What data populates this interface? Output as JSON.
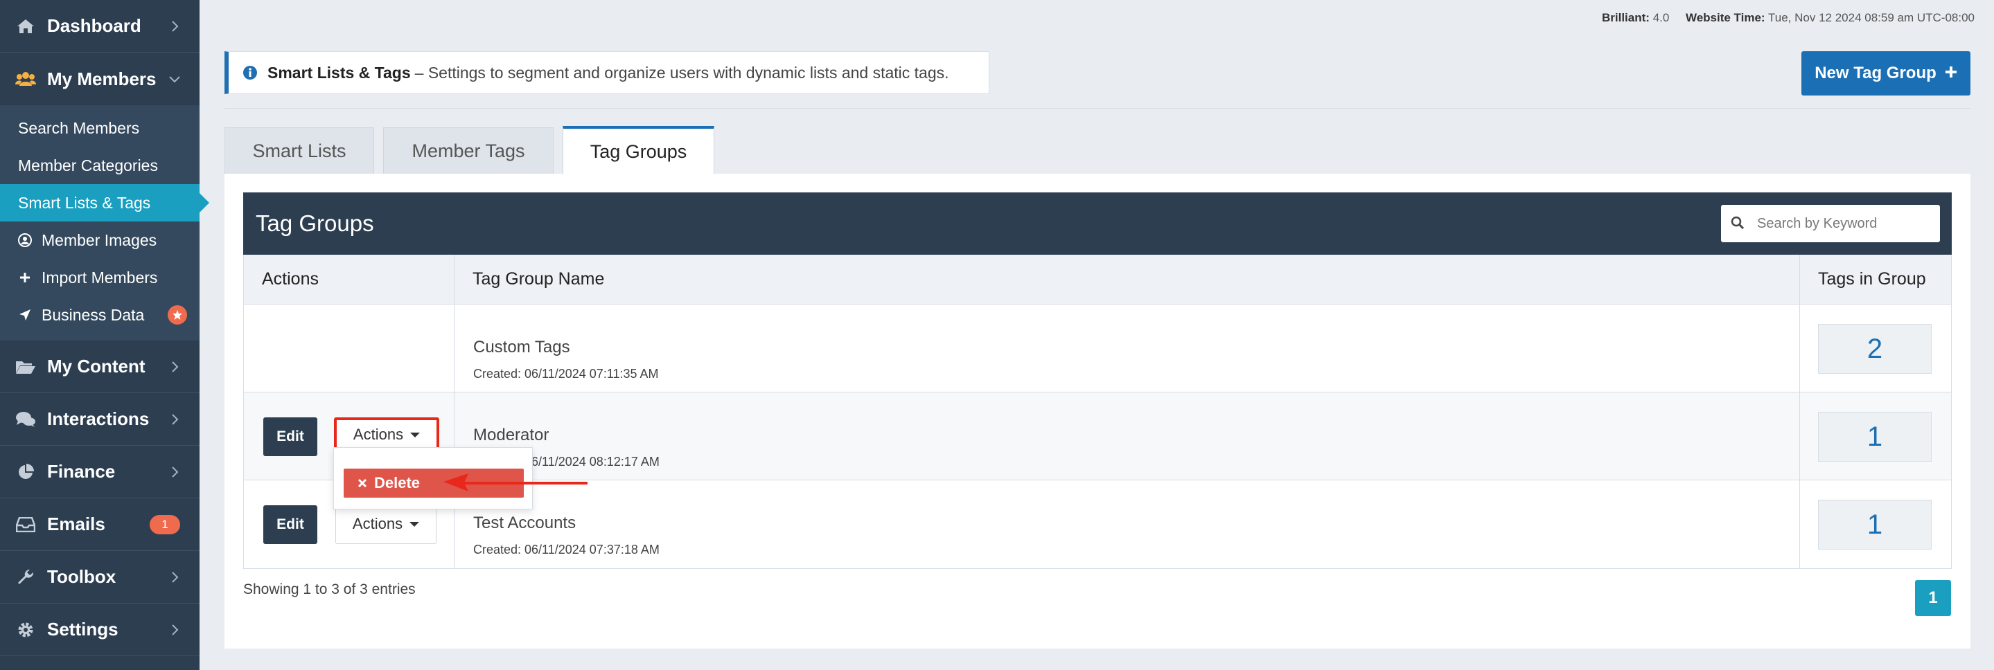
{
  "sidebar": {
    "dashboard": "Dashboard",
    "my_members": "My Members",
    "sub_items": [
      {
        "label": "Search Members"
      },
      {
        "label": "Member Categories"
      },
      {
        "label": "Smart Lists & Tags"
      },
      {
        "label": "Member Images"
      },
      {
        "label": "Import Members"
      },
      {
        "label": "Business Data"
      }
    ],
    "my_content": "My Content",
    "interactions": "Interactions",
    "finance": "Finance",
    "emails": "Emails",
    "emails_badge": "1",
    "toolbox": "Toolbox",
    "settings": "Settings"
  },
  "topinfo": {
    "brilliant_label": "Brilliant:",
    "brilliant_value": "4.0",
    "time_label": "Website Time:",
    "time_value": "Tue, Nov 12 2024 08:59 am UTC-08:00"
  },
  "infobox": {
    "title": "Smart Lists & Tags",
    "text": "– Settings to segment and organize users with dynamic lists and static tags."
  },
  "new_button": "New Tag Group",
  "tabs": [
    "Smart Lists",
    "Member Tags",
    "Tag Groups"
  ],
  "card": {
    "title": "Tag Groups",
    "search_placeholder": "Search by Keyword"
  },
  "table": {
    "headers": [
      "Actions",
      "Tag Group Name",
      "Tags in Group"
    ],
    "rows": [
      {
        "name": "Custom Tags",
        "created": "Created: 06/11/2024 07:11:35 AM",
        "count": "2"
      },
      {
        "name": "Moderator",
        "created": "Created: 06/11/2024 08:12:17 AM",
        "count": "1"
      },
      {
        "name": "Test Accounts",
        "created": "Created: 06/11/2024 07:37:18 AM",
        "count": "1"
      }
    ],
    "edit_label": "Edit",
    "actions_label": "Actions",
    "delete_label": "Delete"
  },
  "footer": {
    "showing": "Showing 1 to 3 of 3 entries",
    "page": "1"
  },
  "colors": {
    "sidebar": "#2c3e50",
    "accent": "#1a6fb5",
    "active": "#1a9fc0",
    "danger": "#e0554a",
    "highlight": "#e8281b"
  }
}
